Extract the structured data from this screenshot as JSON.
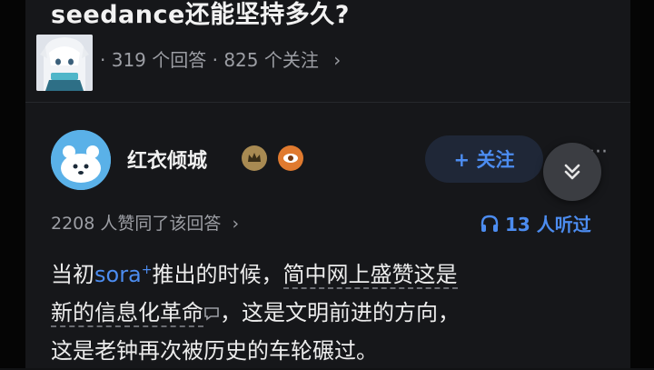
{
  "question": {
    "title": "seedance还能坚持多久?",
    "stats": "· 319 个回答 · 825 个关注",
    "chevron": "›"
  },
  "answer": {
    "author_name": "红衣倾城",
    "follow_label": "+ 关注",
    "more_label": "···",
    "likes_text": "2208 人赞同了该回答",
    "likes_chevron": "›",
    "listen_text": "13 人听过",
    "body": {
      "line1_a": "当初",
      "sora": "sora",
      "sora_sup": "+",
      "line1_b": "推出的时候，",
      "line1_c": "简中网上盛赞这是",
      "line2_a": "新的信息化革命",
      "line2_b": "，这是文明前进的方向，",
      "line3": "这是老钟再次被历史的车轮碾过。"
    }
  },
  "icons": {
    "badge1": "crown-badge-icon",
    "badge2": "eye-badge-icon",
    "collapse": "chevron-double-down-icon",
    "listen": "headphones-icon",
    "comment": "comment-bubble-icon"
  },
  "colors": {
    "background": "#16171a",
    "accent": "#4c8cf0",
    "muted": "#9c9ea4"
  }
}
